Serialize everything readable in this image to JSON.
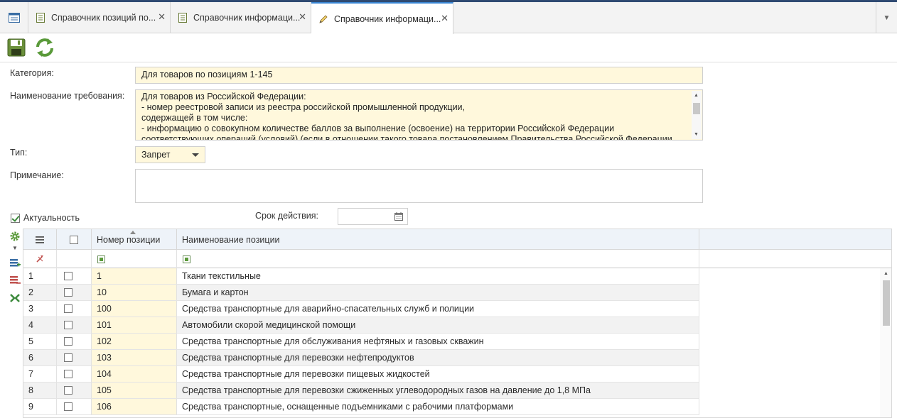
{
  "tabs": [
    {
      "label": "Справочник позиций по...",
      "icon": "document-icon"
    },
    {
      "label": "Справочник информаци...",
      "icon": "document-icon"
    },
    {
      "label": "Справочник информаци...",
      "icon": "pencil-icon",
      "active": true
    }
  ],
  "toolbar": {
    "save": "save-icon",
    "refresh": "refresh-icon"
  },
  "form": {
    "category_label": "Категория:",
    "category_value": "Для товаров по позициям 1-145",
    "requirement_label": "Наименование требования:",
    "requirement_lines": [
      "Для товаров из Российской Федерации:",
      "- номер реестровой записи из реестра российской промышленной продукции,",
      "содержащей в том числе:",
      "- информацию о совокупном количестве баллов за выполнение (освоение) на территории Российской Федерации",
      "соответствующих операций (условий) (если в отношении такого товара постановлением Правительства Российской Федерации"
    ],
    "type_label": "Тип:",
    "type_value": "Запрет",
    "note_label": "Примечание:",
    "note_value": "",
    "actual_label": "Актуальность",
    "actual_checked": true,
    "validity_label": "Срок действия:",
    "validity_value": ""
  },
  "grid": {
    "columns": [
      "Номер позиции",
      "Наименование позиции"
    ],
    "rows": [
      {
        "n": "1",
        "code": "1",
        "name": "Ткани текстильные"
      },
      {
        "n": "2",
        "code": "10",
        "name": "Бумага и картон"
      },
      {
        "n": "3",
        "code": "100",
        "name": "Средства транспортные для аварийно-спасательных служб и полиции"
      },
      {
        "n": "4",
        "code": "101",
        "name": "Автомобили скорой медицинской помощи"
      },
      {
        "n": "5",
        "code": "102",
        "name": "Средства транспортные для обслуживания нефтяных и газовых скважин"
      },
      {
        "n": "6",
        "code": "103",
        "name": "Средства транспортные для перевозки нефтепродуктов"
      },
      {
        "n": "7",
        "code": "104",
        "name": "Средства транспортные для перевозки пищевых жидкостей"
      },
      {
        "n": "8",
        "code": "105",
        "name": "Средства транспортные для перевозки сжиженных углеводородных газов на давление до 1,8 МПа"
      },
      {
        "n": "9",
        "code": "106",
        "name": "Средства транспортные, оснащенные подъемниками с рабочими платформами"
      }
    ]
  },
  "colors": {
    "accent": "#3a86d4",
    "field_bg": "#fff8dc",
    "header_bg": "#eef3f9"
  }
}
